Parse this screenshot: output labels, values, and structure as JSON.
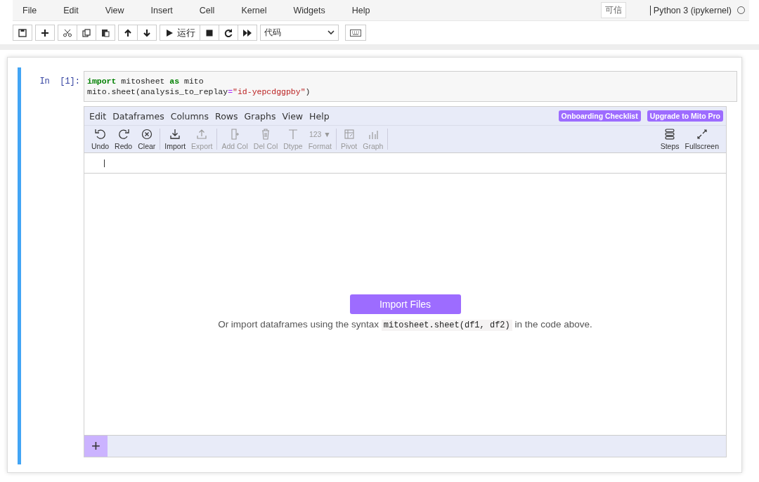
{
  "menu": [
    "File",
    "Edit",
    "View",
    "Insert",
    "Cell",
    "Kernel",
    "Widgets",
    "Help"
  ],
  "trusted": "可信",
  "kernel": {
    "name": "Python 3 (ipykernel)",
    "busy": false
  },
  "toolbar": [
    [
      {
        "kind": "save"
      }
    ],
    [
      {
        "kind": "add"
      }
    ],
    [
      {
        "kind": "cut"
      },
      {
        "kind": "copy"
      },
      {
        "kind": "paste"
      }
    ],
    [
      {
        "kind": "up"
      },
      {
        "kind": "down"
      }
    ],
    [
      {
        "kind": "run",
        "label": "运行"
      },
      {
        "kind": "stop"
      },
      {
        "kind": "restart"
      },
      {
        "kind": "fast-forward"
      }
    ]
  ],
  "cell_type": "代码",
  "cell": {
    "prompt": "In  [1]:",
    "code": [
      [
        {
          "kind": "keyword",
          "text": "import"
        },
        {
          "kind": "plain",
          "text": " mitosheet "
        },
        {
          "kind": "keyword",
          "text": "as"
        },
        {
          "kind": "plain",
          "text": " mito"
        }
      ],
      [
        {
          "kind": "plain",
          "text": "mito.sheet(analysis_to_replay"
        },
        {
          "kind": "operator",
          "text": "="
        },
        {
          "kind": "string",
          "text": "\"id-yepcdggpby\""
        },
        {
          "kind": "plain",
          "text": ")"
        }
      ]
    ]
  },
  "mito": {
    "menu": [
      "Edit",
      "Dataframes",
      "Columns",
      "Rows",
      "Graphs",
      "View",
      "Help"
    ],
    "badges": [
      "Onboarding Checklist",
      "Upgrade to Mito Pro"
    ],
    "tool_groups": [
      [
        {
          "kind": "undo",
          "label": "Undo",
          "disabled": false
        },
        {
          "kind": "redo",
          "label": "Redo",
          "disabled": false
        },
        {
          "kind": "clear",
          "label": "Clear",
          "disabled": false
        }
      ],
      [
        {
          "kind": "import",
          "label": "Import",
          "disabled": false
        },
        {
          "kind": "export",
          "label": "Export",
          "disabled": true
        }
      ],
      [
        {
          "kind": "add-col",
          "label": "Add Col",
          "disabled": true
        },
        {
          "kind": "del-col",
          "label": "Del Col",
          "disabled": true
        },
        {
          "kind": "dtype",
          "label": "Dtype",
          "disabled": true
        },
        {
          "kind": "format",
          "label": "Format",
          "glyph": "123 ▼",
          "disabled": true
        }
      ],
      [
        {
          "kind": "pivot",
          "label": "Pivot",
          "disabled": true
        },
        {
          "kind": "graph",
          "label": "Graph",
          "disabled": true
        }
      ]
    ],
    "right_tools": [
      {
        "kind": "steps",
        "label": "Steps",
        "disabled": false
      },
      {
        "kind": "fullscreen",
        "label": "Fullscreen",
        "disabled": false
      }
    ],
    "import_button": "Import Files",
    "hint": {
      "before": "Or import dataframes using the syntax",
      "code": "mitosheet.sheet(df1, df2)",
      "after": "in the code above."
    },
    "add_sheet": "+"
  }
}
